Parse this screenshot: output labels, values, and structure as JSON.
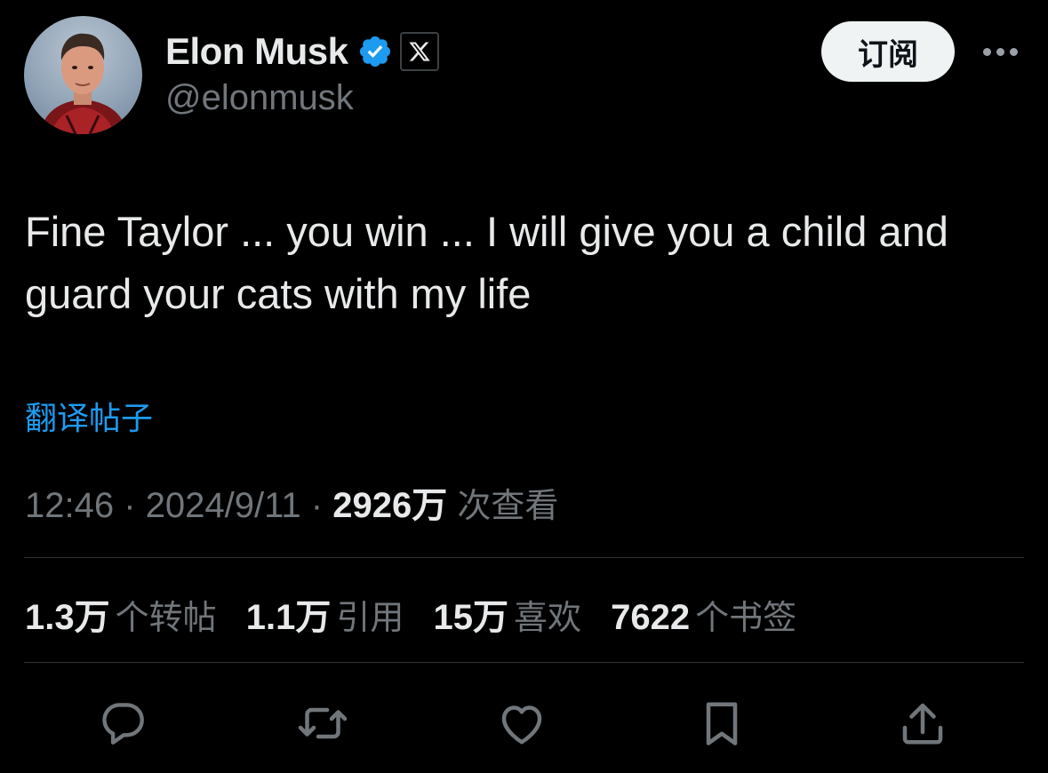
{
  "author": {
    "name": "Elon Musk",
    "handle": "@elonmusk",
    "verified_color": "#1d9bf0"
  },
  "header": {
    "subscribe_label": "订阅",
    "more_icon": "more-horizontal-icon"
  },
  "tweet": {
    "text_line1": "Fine Taylor ... you win ... I will give you a child and",
    "text_line2": "guard your cats with my life",
    "translate_label": "翻译帖子"
  },
  "meta": {
    "time": "12:46",
    "date": "2024/9/11",
    "separator": "·",
    "views_count": "2926万",
    "views_label": "次查看"
  },
  "stats": [
    {
      "count": "1.3万",
      "label": "个转帖"
    },
    {
      "count": "1.1万",
      "label": "引用"
    },
    {
      "count": "15万",
      "label": "喜欢"
    },
    {
      "count": "7622",
      "label": "个书签"
    }
  ],
  "actions": [
    "reply-icon",
    "repost-icon",
    "like-icon",
    "bookmark-icon",
    "share-icon"
  ],
  "colors": {
    "background": "#000000",
    "text": "#e7e9ea",
    "secondary": "#71767b",
    "accent": "#1d9bf0",
    "divider": "#2f3336"
  }
}
